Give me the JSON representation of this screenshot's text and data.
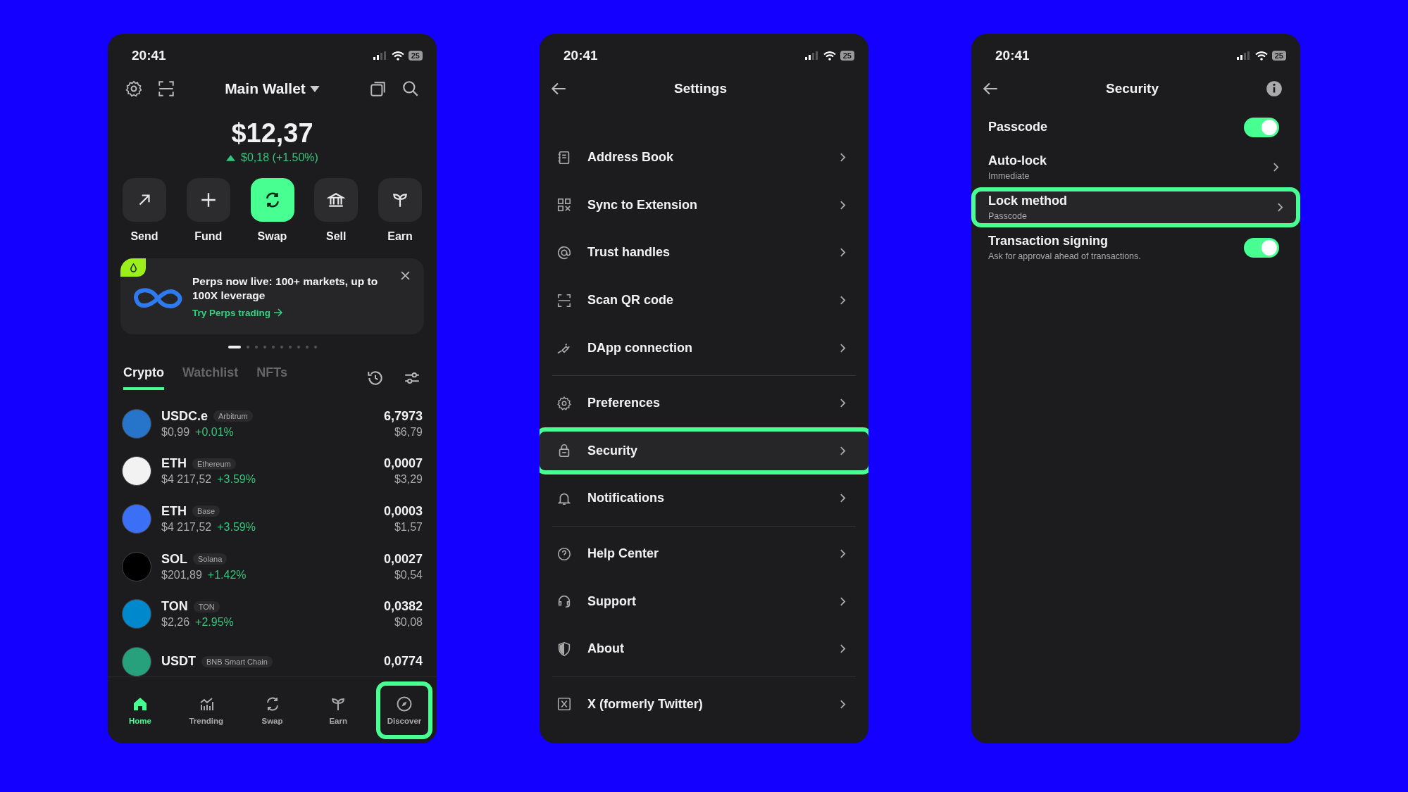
{
  "wallet_screen": {
    "status_bar": {
      "time": "20:41",
      "battery": "25"
    },
    "header": {
      "title": "Main Wallet"
    },
    "balance": {
      "amount": "$12,37",
      "change": "$0,18 (+1.50%)"
    },
    "actions": [
      {
        "label": "Send",
        "kind": "send",
        "selected": false
      },
      {
        "label": "Fund",
        "kind": "fund",
        "selected": false
      },
      {
        "label": "Swap",
        "kind": "swap",
        "selected": true
      },
      {
        "label": "Sell",
        "kind": "sell",
        "selected": false
      },
      {
        "label": "Earn",
        "kind": "earn",
        "selected": false
      }
    ],
    "banner": {
      "text": "Perps now live: 100+ markets, up to 100X leverage",
      "link": "Try Perps trading"
    },
    "pager_dots": [
      {
        "selected": true
      },
      {
        "selected": false
      },
      {
        "selected": false
      },
      {
        "selected": false
      },
      {
        "selected": false
      },
      {
        "selected": false
      },
      {
        "selected": false
      },
      {
        "selected": false
      },
      {
        "selected": false
      },
      {
        "selected": false
      }
    ],
    "tabs": [
      {
        "label": "Crypto",
        "selected": true
      },
      {
        "label": "Watchlist",
        "selected": false
      },
      {
        "label": "NFTs",
        "selected": false
      }
    ],
    "tokens": [
      {
        "symbol": "USDC.e",
        "network": "Arbitrum",
        "price": "$0,99",
        "change": "+0.01%",
        "amount": "6,7973",
        "value": "$6,79",
        "color": "#2775ca"
      },
      {
        "symbol": "ETH",
        "network": "Ethereum",
        "price": "$4 217,52",
        "change": "+3.59%",
        "amount": "0,0007",
        "value": "$3,29",
        "color": "#f2f2f2"
      },
      {
        "symbol": "ETH",
        "network": "Base",
        "price": "$4 217,52",
        "change": "+3.59%",
        "amount": "0,0003",
        "value": "$1,57",
        "color": "#3b6ff5"
      },
      {
        "symbol": "SOL",
        "network": "Solana",
        "price": "$201,89",
        "change": "+1.42%",
        "amount": "0,0027",
        "value": "$0,54",
        "color": "#000000"
      },
      {
        "symbol": "TON",
        "network": "TON",
        "price": "$2,26",
        "change": "+2.95%",
        "amount": "0,0382",
        "value": "$0,08",
        "color": "#0088cc"
      },
      {
        "symbol": "USDT",
        "network": "BNB Smart Chain",
        "amount": "0,0774",
        "color": "#26a17b"
      }
    ],
    "nav": [
      {
        "label": "Home",
        "kind": "home",
        "selected": true,
        "highlighted": false
      },
      {
        "label": "Trending",
        "kind": "trending",
        "selected": false,
        "highlighted": false
      },
      {
        "label": "Swap",
        "kind": "swap",
        "selected": false,
        "highlighted": false
      },
      {
        "label": "Earn",
        "kind": "earn",
        "selected": false,
        "highlighted": false
      },
      {
        "label": "Discover",
        "kind": "discover",
        "selected": false,
        "highlighted": true
      }
    ]
  },
  "settings_screen": {
    "status_bar": {
      "time": "20:41",
      "battery": "25"
    },
    "title": "Settings",
    "groups": [
      [
        {
          "label": "Address Book",
          "kind": "book",
          "highlighted": false
        },
        {
          "label": "Sync to Extension",
          "kind": "qr",
          "highlighted": false
        },
        {
          "label": "Trust handles",
          "kind": "at",
          "highlighted": false
        },
        {
          "label": "Scan QR code",
          "kind": "scan",
          "highlighted": false
        },
        {
          "label": "DApp connection",
          "kind": "plug",
          "highlighted": false
        }
      ],
      [
        {
          "label": "Preferences",
          "kind": "gear",
          "highlighted": false
        },
        {
          "label": "Security",
          "kind": "lock",
          "highlighted": true
        },
        {
          "label": "Notifications",
          "kind": "bell",
          "highlighted": false
        }
      ],
      [
        {
          "label": "Help Center",
          "kind": "help",
          "highlighted": false
        },
        {
          "label": "Support",
          "kind": "headset",
          "highlighted": false
        },
        {
          "label": "About",
          "kind": "shield",
          "highlighted": false
        }
      ],
      [
        {
          "label": "X (formerly Twitter)",
          "kind": "x",
          "highlighted": false
        }
      ]
    ]
  },
  "security_screen": {
    "status_bar": {
      "time": "20:41",
      "battery": "25"
    },
    "title": "Security",
    "items": [
      {
        "kind": "toggle",
        "label": "Passcode",
        "on": true,
        "highlighted": false
      },
      {
        "kind": "link",
        "label": "Auto-lock",
        "subtitle": "Immediate",
        "highlighted": false
      },
      {
        "kind": "link",
        "label": "Lock method",
        "subtitle": "Passcode",
        "highlighted": true
      },
      {
        "kind": "toggle",
        "label": "Transaction signing",
        "subtitle": "Ask for approval ahead of transactions.",
        "on": true,
        "highlighted": false
      }
    ]
  }
}
